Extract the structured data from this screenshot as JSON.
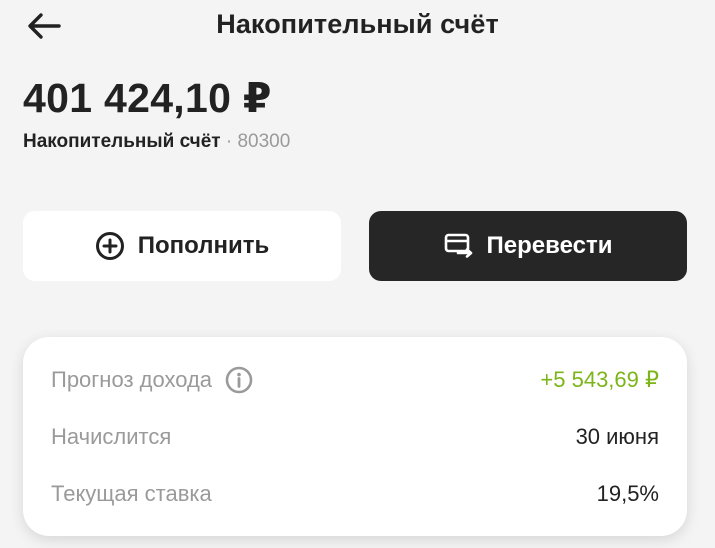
{
  "header": {
    "title": "Накопительный счёт",
    "back_icon": "arrow-left-icon"
  },
  "account": {
    "balance": "401 424,10 ₽",
    "name": "Накопительный счёт",
    "separator": " · ",
    "number": "80300"
  },
  "actions": {
    "topup": {
      "label": "Пополнить",
      "icon": "plus-circle-icon"
    },
    "transfer": {
      "label": "Перевести",
      "icon": "transfer-card-icon"
    }
  },
  "details": {
    "income_forecast": {
      "label": "Прогноз дохода",
      "value": "+5 543,69 ₽"
    },
    "accrual_date": {
      "label": "Начислится",
      "value": "30 июня"
    },
    "current_rate": {
      "label": "Текущая ставка",
      "value": "19,5%"
    }
  },
  "colors": {
    "background": "#f4f4f4",
    "primary_button": "#262626",
    "positive": "#7cb518",
    "muted": "#9a9a9a",
    "text": "#222222"
  }
}
